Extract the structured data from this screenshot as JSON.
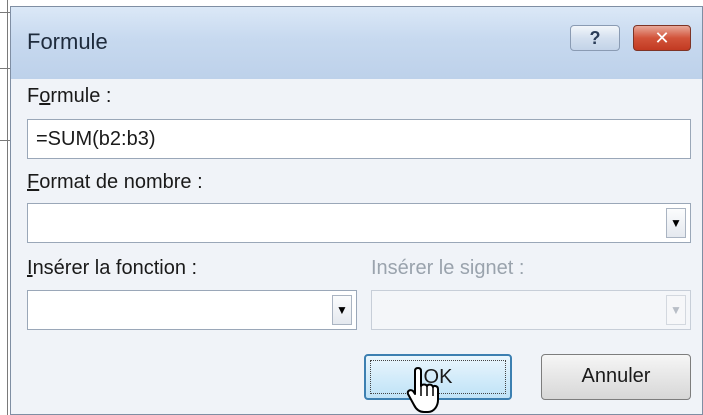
{
  "window": {
    "title": "Formule",
    "help_glyph": "?",
    "close_glyph": "✕"
  },
  "formula": {
    "label_accel": "o",
    "label_pre": "F",
    "label_post": "rmule :",
    "value": "=SUM(b2:b3)"
  },
  "number_format": {
    "label_accel": "F",
    "label_rest": "ormat de nombre :",
    "value": ""
  },
  "insert_function": {
    "label_accel": "I",
    "label_rest": "nsérer la fonction :",
    "value": ""
  },
  "insert_bookmark": {
    "label": "Insérer le signet :",
    "value": "",
    "disabled": true
  },
  "buttons": {
    "ok": "OK",
    "cancel": "Annuler"
  },
  "icons": {
    "dropdown": "chevron-down-icon",
    "cursor": "mouse-pointer-icon"
  }
}
